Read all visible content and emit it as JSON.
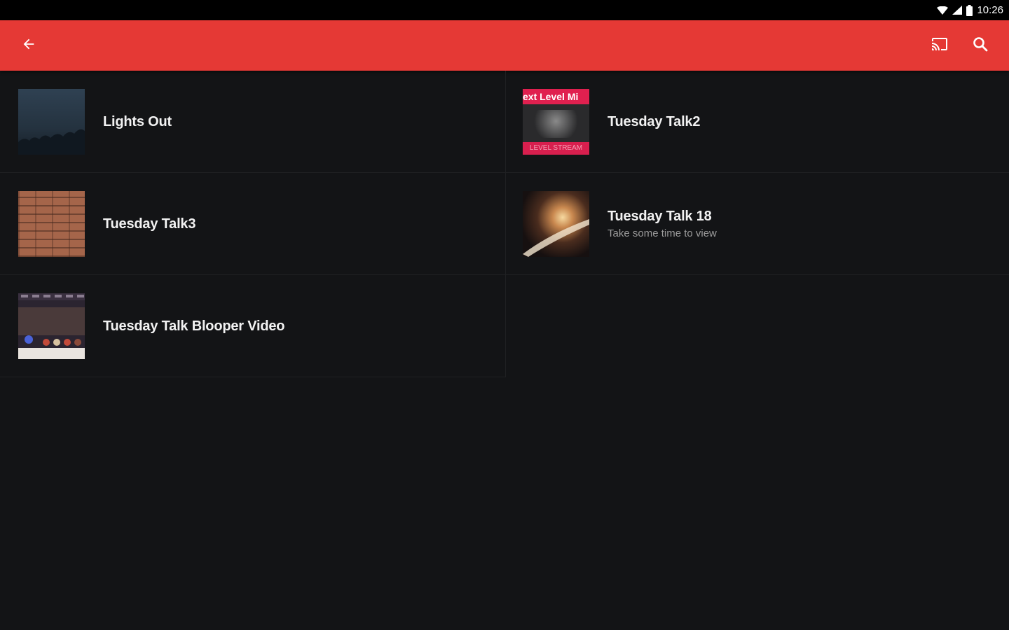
{
  "status_bar": {
    "time": "10:26",
    "icons": [
      "wifi-icon",
      "cell-signal-icon",
      "battery-icon"
    ]
  },
  "app_bar": {
    "color": "#e53935",
    "icons": [
      "back-arrow-icon",
      "cast-icon",
      "search-icon"
    ]
  },
  "videos": [
    {
      "title": "Lights Out",
      "subtitle": ""
    },
    {
      "title": "Tuesday Talk2",
      "subtitle": "",
      "thumb_text_top": "ext Level Mi",
      "thumb_text_bottom": "LEVEL STREAM"
    },
    {
      "title": "Tuesday Talk3",
      "subtitle": ""
    },
    {
      "title": "Tuesday Talk 18",
      "subtitle": "Take some time to view"
    },
    {
      "title": "Tuesday Talk Blooper Video",
      "subtitle": ""
    }
  ]
}
